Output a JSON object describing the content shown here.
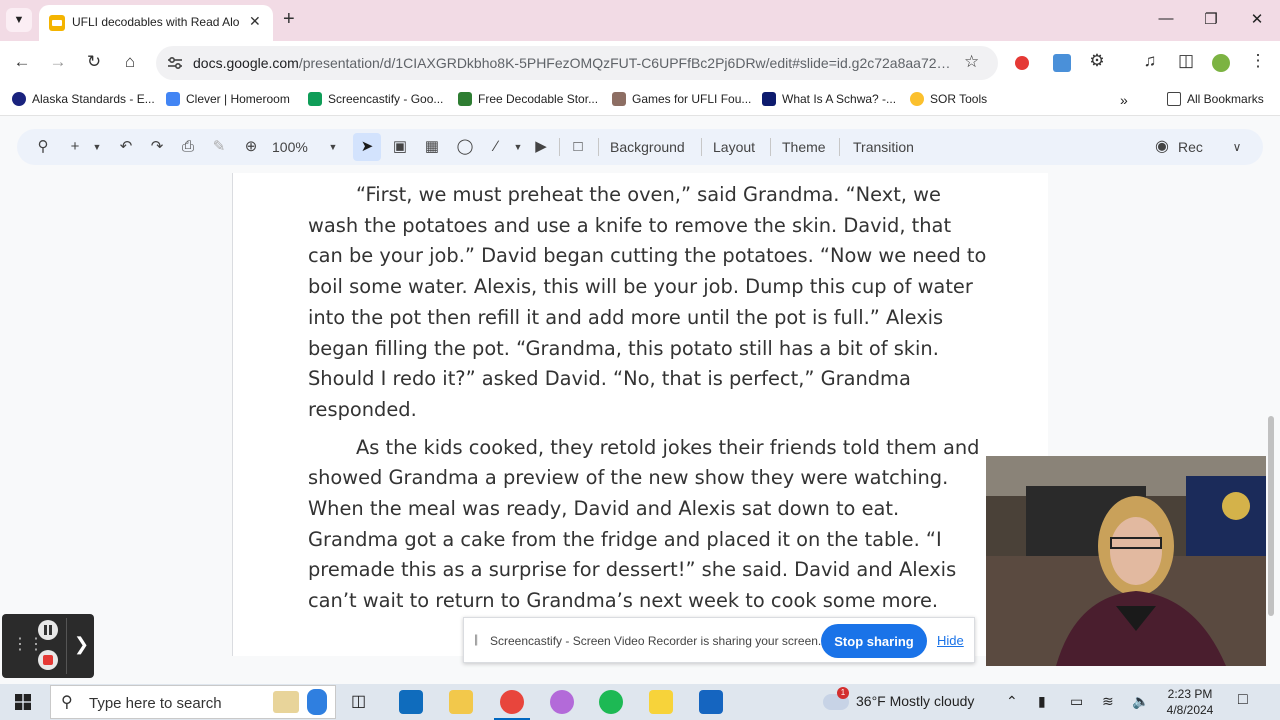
{
  "browser": {
    "tab_title": "UFLI decodables with Read Alo",
    "url_host": "docs.google.com",
    "url_path": "/presentation/d/1CIAXGRDkbho8K-5PHFezOMQzFUT-C6UPFfBc2Pj6DRw/edit#slide=id.g2c72a8aa72e_0_..."
  },
  "bookmarks": [
    {
      "label": "Alaska Standards - E...",
      "color": "#1a237e"
    },
    {
      "label": "Clever | Homeroom",
      "color": "#4285f4"
    },
    {
      "label": "Screencastify - Goo...",
      "color": "#0f9d58"
    },
    {
      "label": "Free Decodable Stor...",
      "color": "#2e7d32"
    },
    {
      "label": "Games for UFLI Fou...",
      "color": "#8d6e63"
    },
    {
      "label": "What Is A Schwa? -...",
      "color": "#0d1b6e"
    },
    {
      "label": "SOR Tools",
      "color": "#fbc02d"
    }
  ],
  "all_bookmarks": "All Bookmarks",
  "slides_toolbar": {
    "zoom": "100%",
    "background": "Background",
    "layout": "Layout",
    "theme": "Theme",
    "transition": "Transition",
    "rec": "Rec"
  },
  "story": {
    "paragraph_1": "“First, we must preheat the oven,” said Grandma. “Next, we wash the potatoes and use a knife to remove the skin. David, that can be your job.” David began cutting the potatoes. “Now we need to boil some water. Alexis, this will be your job. Dump this cup of water into the pot then refill it and add more until the pot is full.” Alexis began filling the pot. “Grandma, this potato still has a bit of skin. Should I redo it?” asked David. “No, that is perfect,” Grandma responded.",
    "paragraph_2": "As the kids cooked, they retold jokes their friends told them and showed Grandma a preview of the new show they were watching. When the meal was ready, David and Alexis sat down to eat. Grandma got a cake from the fridge and placed it on the table. “I premade this as a surprise for dessert!” she said. David and Alexis can’t wait to return to Grandma’s next week to cook some more."
  },
  "share_bar": {
    "message": "Screencastify - Screen Video Recorder is sharing your screen.",
    "stop": "Stop sharing",
    "hide": "Hide"
  },
  "taskbar": {
    "search_placeholder": "Type here to search",
    "weather": "36°F  Mostly cloudy",
    "time": "2:23 PM",
    "date": "4/8/2024",
    "notification_count": "1"
  }
}
